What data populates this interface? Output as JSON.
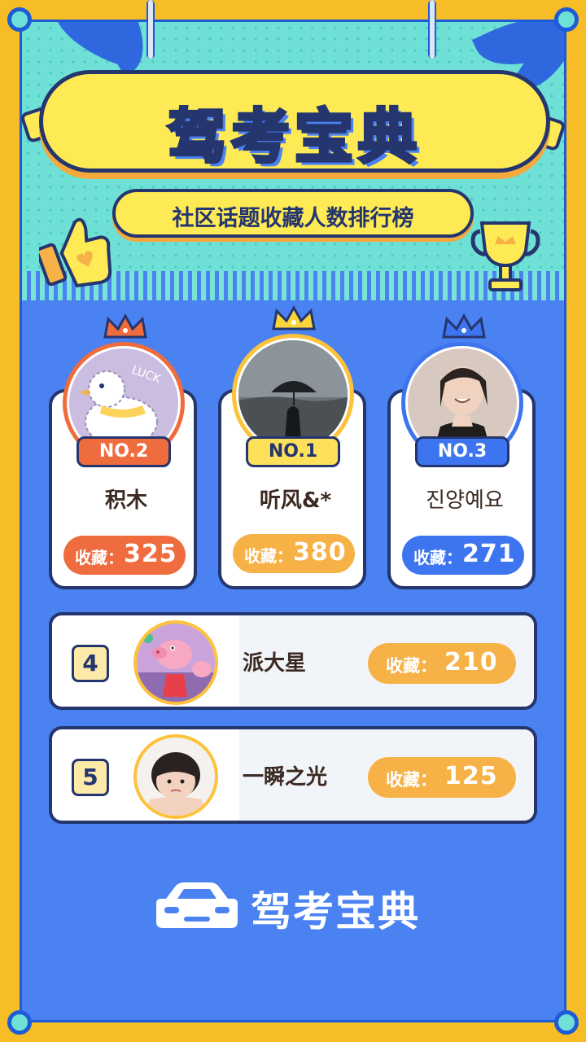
{
  "header": {
    "title": "驾考宝典",
    "subtitle": "社区话题收藏人数排行榜"
  },
  "podium": [
    {
      "rank_label": "NO.2",
      "name": "积木",
      "count_label": "收藏：",
      "count": "325",
      "color": "#ee6c3d",
      "tag_color": "#ee6c3d",
      "avatar": "duck-avatar"
    },
    {
      "rank_label": "NO.1",
      "name": "听风&*",
      "count_label": "收藏：",
      "count": "380",
      "color": "#f6b246",
      "tag_color": "#fde15a",
      "avatar": "umbrella-avatar"
    },
    {
      "rank_label": "NO.3",
      "name": "진양예요",
      "count_label": "收藏：",
      "count": "271",
      "color": "#3d74ef",
      "tag_color": "#3d74ef",
      "avatar": "girl-avatar"
    }
  ],
  "list": [
    {
      "rank": "4",
      "name": "派大星",
      "count_label": "收藏：",
      "count": "210",
      "avatar": "pig-avatar"
    },
    {
      "rank": "5",
      "name": "一瞬之光",
      "count_label": "收藏：",
      "count": "125",
      "avatar": "child-avatar"
    }
  ],
  "footer": {
    "brand": "驾考宝典",
    "logo": "car-icon"
  },
  "colors": {
    "frame": "#f6bd27",
    "background": "#4a82f2",
    "header": "#6fe0d6",
    "outline": "#25356e",
    "banner": "#fdea55"
  }
}
